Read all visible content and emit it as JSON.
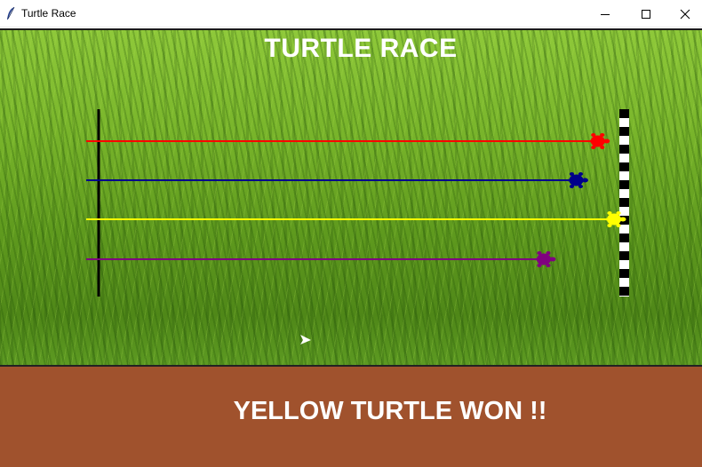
{
  "window": {
    "title": "Turtle Race",
    "app_icon": "feather-icon",
    "controls": [
      "minimize-icon",
      "maximize-icon",
      "close-icon"
    ]
  },
  "canvas": {
    "heading": "TURTLE RACE",
    "background": "grass",
    "turtles": [
      {
        "color": "red",
        "hex": "#ff0000",
        "progress": 0.97
      },
      {
        "color": "blue",
        "hex": "#00008b",
        "progress": 0.93
      },
      {
        "color": "yellow",
        "hex": "#ffff00",
        "progress": 1.0
      },
      {
        "color": "purple",
        "hex": "#800080",
        "progress": 0.87
      }
    ],
    "start_line_color": "#000000",
    "finish_line": "checkered"
  },
  "result": {
    "message": "YELLOW TURTLE WON !!",
    "background": "#a0522d"
  }
}
